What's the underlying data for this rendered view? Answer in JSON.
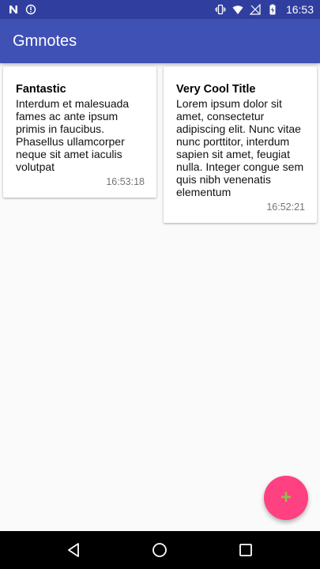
{
  "status_bar": {
    "time": "16:53",
    "left_icons": [
      "n-icon",
      "alert-icon"
    ],
    "right_icons": [
      "vibrate-icon",
      "wifi-icon",
      "no-signal-icon",
      "battery-charging-icon"
    ]
  },
  "app_bar": {
    "title": "Gmnotes",
    "color": "#3f51b5"
  },
  "notes": [
    {
      "title": "Fantastic",
      "body": "Interdum et malesuada fames ac ante ipsum primis in faucibus. Phasellus ullamcorper neque sit amet iaculis volutpat",
      "time": "16:53:18"
    },
    {
      "title": "Very Cool Title",
      "body": "Lorem ipsum dolor sit amet, consectetur adipiscing elit. Nunc vitae nunc porttitor, interdum sapien sit amet, feugiat nulla. Integer congue sem quis nibh venenatis elementum",
      "time": "16:52:21"
    }
  ],
  "fab": {
    "label": "+",
    "color": "#ff4081",
    "icon_color": "#8bc34a"
  },
  "nav_bar": {
    "buttons": [
      "back-icon",
      "home-icon",
      "recents-icon"
    ]
  }
}
